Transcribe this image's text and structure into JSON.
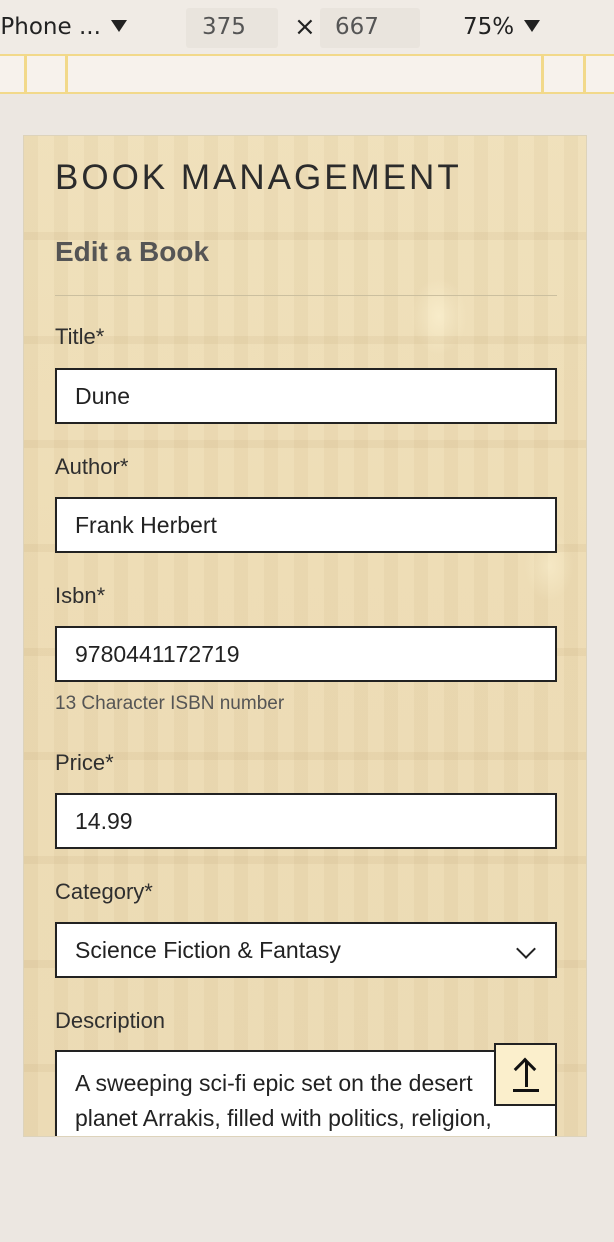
{
  "devtools": {
    "device": "iPhone ...",
    "width": "375",
    "times": "×",
    "height": "667",
    "zoom": "75%"
  },
  "page": {
    "heading": "BOOK MANAGEMENT",
    "subheading": "Edit a Book"
  },
  "form": {
    "title": {
      "label": "Title*",
      "value": "Dune"
    },
    "author": {
      "label": "Author*",
      "value": "Frank Herbert"
    },
    "isbn": {
      "label": "Isbn*",
      "value": "9780441172719",
      "hint": "13 Character ISBN number"
    },
    "price": {
      "label": "Price*",
      "value": "14.99"
    },
    "category": {
      "label": "Category*",
      "value": "Science Fiction & Fantasy"
    },
    "description": {
      "label": "Description",
      "value": "A sweeping sci-fi epic set on the desert planet Arrakis, filled with politics, religion,"
    }
  },
  "icons": {
    "back_to_top": "arrow-up-icon",
    "select": "chevron-down-icon",
    "dropdown": "triangle-down-icon"
  }
}
